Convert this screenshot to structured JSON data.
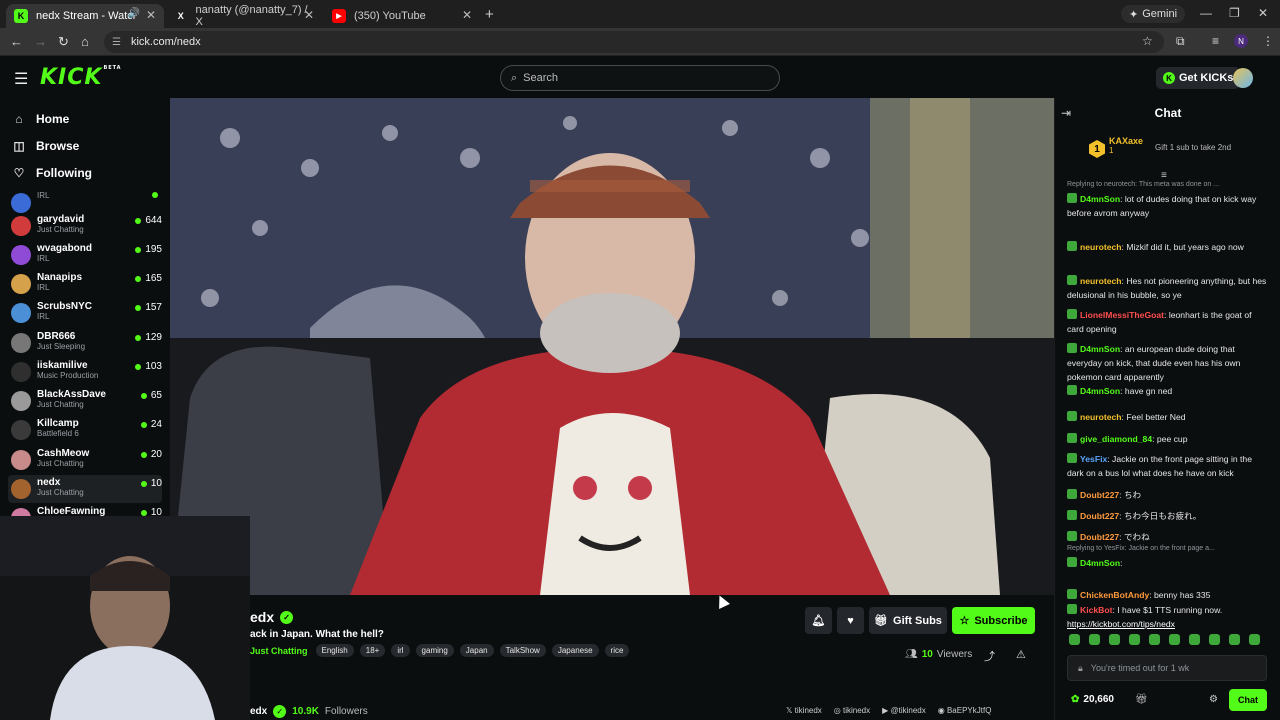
{
  "browser": {
    "tabs": [
      {
        "title": "nedx Stream - Watch Live o",
        "icon": "kick-favicon",
        "active": true
      },
      {
        "title": "nanatty (@nanatty_7) / X",
        "icon": "x-favicon",
        "active": false
      },
      {
        "title": "(350) YouTube",
        "icon": "youtube-favicon",
        "active": false
      }
    ],
    "new_tab_symbol": "+",
    "gemini_label": "Gemini",
    "url": "kick.com/nedx",
    "profile_initial": "N"
  },
  "kick": {
    "logo": "KICK",
    "logo_beta": "BETA",
    "search_placeholder": "Search",
    "get_kicks_label": "Get KICKs",
    "nav": [
      {
        "label": "Home",
        "icon": "home-icon"
      },
      {
        "label": "Browse",
        "icon": "browse-icon"
      },
      {
        "label": "Following",
        "icon": "heart-icon"
      }
    ],
    "following": [
      {
        "name": "",
        "category": "IRL",
        "viewers": "",
        "color": "#3b6bd6"
      },
      {
        "name": "garydavid",
        "category": "Just Chatting",
        "viewers": "644",
        "color": "#d23b3b"
      },
      {
        "name": "wvagabond",
        "category": "IRL",
        "viewers": "195",
        "color": "#8f4bd6"
      },
      {
        "name": "Nanapips",
        "category": "IRL",
        "viewers": "165",
        "color": "#d6a14b"
      },
      {
        "name": "ScrubsNYC",
        "category": "IRL",
        "viewers": "157",
        "color": "#4b8fd6"
      },
      {
        "name": "DBR666",
        "category": "Just Sleeping",
        "viewers": "129",
        "color": "#777777"
      },
      {
        "name": "iiskamilive",
        "category": "Music Production",
        "viewers": "103",
        "color": "#2f2f2f"
      },
      {
        "name": "BlackAssDave",
        "category": "Just Chatting",
        "viewers": "65",
        "color": "#9a9a9a"
      },
      {
        "name": "Killcamp",
        "category": "Battlefield 6",
        "viewers": "24",
        "color": "#3a3a3a"
      },
      {
        "name": "CashMeow",
        "category": "Just Chatting",
        "viewers": "20",
        "color": "#c98a8a"
      },
      {
        "name": "nedx",
        "category": "Just Chatting",
        "viewers": "10",
        "color": "#a3632e"
      },
      {
        "name": "ChloeFawning",
        "category": "",
        "viewers": "10",
        "color": "#cf7aa0"
      }
    ]
  },
  "stream": {
    "channel": "edx",
    "title": "ack in Japan. What the hell?",
    "category": "Just Chatting",
    "tags": [
      "English",
      "18+",
      "irl",
      "gaming",
      "Japan",
      "TalkShow",
      "Japanese",
      "rice"
    ],
    "viewers": "10",
    "viewers_label": "Viewers",
    "gift_subs_label": "Gift Subs",
    "subscribe_label": "Subscribe",
    "about_name": "edx",
    "followers": "10.9K",
    "followers_label": "Followers",
    "socials": [
      "tikinedx",
      "tikinedx",
      "@tikinedx",
      "BaEPYkJtfQ"
    ]
  },
  "chat": {
    "title": "Chat",
    "pinned": {
      "rank": "1",
      "name": "KAXaxe",
      "count": "1",
      "gift_text": "Gift 1 sub to take 2nd"
    },
    "messages": [
      {
        "reply": "Replying to neurotech: This meta was done on ...",
        "user": "D4mnSon",
        "color": "#53fc18",
        "text": "lot of dudes doing that on kick way before avrom anyway"
      },
      {
        "reply": "",
        "user": "neurotech",
        "color": "#f2c02a",
        "text": "Mizkif did it, but years ago now"
      },
      {
        "reply": "",
        "user": "neurotech",
        "color": "#f2c02a",
        "text": "Hes not pioneering anything, but hes delusional in his bubble, so ye"
      },
      {
        "reply": "",
        "user": "LionelMessiTheGoat",
        "color": "#ff4d4d",
        "text": "leonhart is the goat of card opening"
      },
      {
        "reply": "",
        "user": "D4mnSon",
        "color": "#53fc18",
        "text": "an european dude doing that everyday on kick, that dude even has his own pokemon card apparently"
      },
      {
        "reply": "",
        "user": "D4mnSon",
        "color": "#53fc18",
        "text": "have gn ned"
      },
      {
        "reply": "",
        "user": "neurotech",
        "color": "#f2c02a",
        "text": "Feel better Ned"
      },
      {
        "reply": "",
        "user": "give_diamond_84",
        "color": "#53fc18",
        "text": "pee cup"
      },
      {
        "reply": "",
        "user": "YesFix",
        "color": "#5aa8ff",
        "text": "Jackie on the front page sitting in the dark on a bus lol what does he have on kick"
      },
      {
        "reply": "",
        "user": "Doubt227",
        "color": "#ff9a3c",
        "text": "ちわ"
      },
      {
        "reply": "",
        "user": "Doubt227",
        "color": "#ff9a3c",
        "text": "ちわ今日もお疲れ。"
      },
      {
        "reply": "",
        "user": "Doubt227",
        "color": "#ff9a3c",
        "text": "でわね"
      },
      {
        "reply": "Replying to YesFix: Jackie on the front page a...",
        "user": "D4mnSon",
        "color": "#53fc18",
        "text": ""
      },
      {
        "reply": "",
        "user": "ChickenBotAndy",
        "color": "#ff9a3c",
        "text": "benny has 335"
      },
      {
        "reply": "",
        "user": "KickBot",
        "color": "#ff4d4d",
        "text": "I have $1 TTS running now.",
        "link": "https://kickbot.com/tips/nedx"
      }
    ],
    "input_placeholder": "You're timed out for 1 wk",
    "kicks_balance": "20,660",
    "send_label": "Chat"
  }
}
